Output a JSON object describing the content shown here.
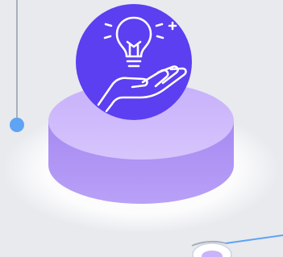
{
  "illustration": {
    "icon": "lightbulb-in-hand-icon",
    "colors": {
      "background": "#e8eaee",
      "circle": "#5b3ff0",
      "pedestal_top": "#c9b3fb",
      "pedestal_side": "#a98af4",
      "connector_dot": "#5fa3f5",
      "connector_line": "#a8b0bd",
      "glow": "#ffffff"
    }
  }
}
